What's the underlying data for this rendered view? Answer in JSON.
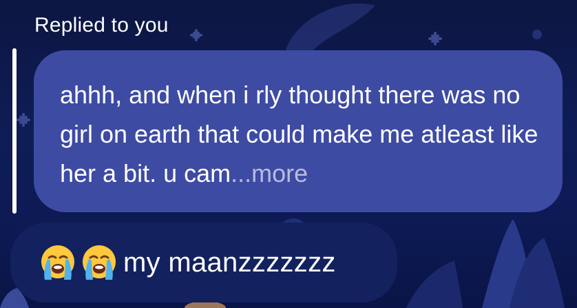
{
  "header": {
    "reply_label": "Replied to you"
  },
  "quoted_message": {
    "text": "ahhh, and when i rly thought there was no girl on earth that could make me atleast like her a bit. u cam",
    "ellipsis": "...",
    "more_label": "more"
  },
  "message": {
    "emojis": [
      "loudly-crying-face",
      "loudly-crying-face"
    ],
    "text": "my maanzzzzzzz"
  },
  "colors": {
    "background": "#0f1d57",
    "quoted_bubble": "#3d4ba3",
    "message_bubble": "#13225e",
    "text": "#ffffff",
    "more_link": "#b8bce0"
  }
}
